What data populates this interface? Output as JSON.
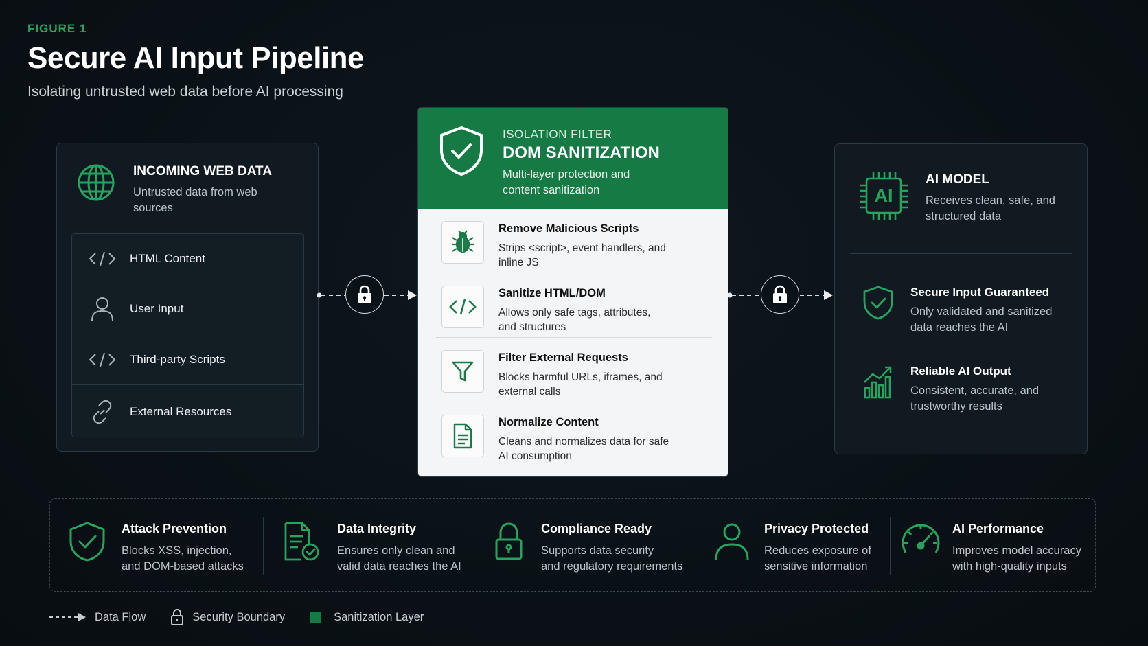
{
  "header": {
    "figure_label": "FIGURE 1",
    "title": "Secure AI Input Pipeline",
    "subtitle": "Isolating untrusted web data before AI processing"
  },
  "colors": {
    "accent": "#167a45",
    "accent_light": "#2fa866",
    "background": "#0a1116",
    "panel": "#111a21"
  },
  "incoming": {
    "icon": "globe-icon",
    "title": "INCOMING WEB DATA",
    "description": "Untrusted data from web sources",
    "items": [
      {
        "icon": "code-icon",
        "label": "HTML Content"
      },
      {
        "icon": "user-icon",
        "label": "User Input"
      },
      {
        "icon": "code-icon",
        "label": "Third-party Scripts"
      },
      {
        "icon": "link-icon",
        "label": "External Resources"
      }
    ]
  },
  "filter": {
    "icon": "shield-check-icon",
    "kicker": "ISOLATION FILTER",
    "title": "DOM SANITIZATION",
    "description": "Multi-layer protection and content sanitization",
    "steps": [
      {
        "icon": "bug-icon",
        "title": "Remove Malicious Scripts",
        "description": "Strips <script>, event handlers, and inline JS"
      },
      {
        "icon": "code-icon",
        "title": "Sanitize HTML/DOM",
        "description": "Allows only safe tags, attributes, and structures"
      },
      {
        "icon": "funnel-icon",
        "title": "Filter External Requests",
        "description": "Blocks harmful URLs, iframes, and external calls"
      },
      {
        "icon": "document-icon",
        "title": "Normalize Content",
        "description": "Cleans and normalizes data for safe AI consumption"
      }
    ]
  },
  "ai_model": {
    "icon": "ai-chip-icon",
    "chip_label": "AI",
    "title": "AI MODEL",
    "description": "Receives clean, safe, and structured data",
    "items": [
      {
        "icon": "shield-check-icon",
        "title": "Secure Input Guaranteed",
        "description": "Only validated and sanitized data reaches the AI"
      },
      {
        "icon": "growth-chart-icon",
        "title": "Reliable AI Output",
        "description": "Consistent, accurate, and trustworthy results"
      }
    ]
  },
  "benefits": [
    {
      "icon": "shield-check-icon",
      "title": "Attack Prevention",
      "line1": "Blocks XSS, injection,",
      "line2": "and DOM-based attacks"
    },
    {
      "icon": "document-check-icon",
      "title": "Data Integrity",
      "line1": "Ensures only clean and",
      "line2": "valid data reaches the AI"
    },
    {
      "icon": "padlock-icon",
      "title": "Compliance Ready",
      "line1": "Supports data security",
      "line2": "and regulatory requirements"
    },
    {
      "icon": "user-icon",
      "title": "Privacy Protected",
      "line1": "Reduces exposure of",
      "line2": "sensitive information"
    },
    {
      "icon": "gauge-icon",
      "title": "AI Performance",
      "line1": "Improves model accuracy",
      "line2": "with high-quality inputs"
    }
  ],
  "legend": [
    {
      "icon": "dashed-arrow-icon",
      "label": "Data Flow"
    },
    {
      "icon": "padlock-icon",
      "label": "Security Boundary"
    },
    {
      "icon": "green-square-icon",
      "label": "Sanitization Layer"
    }
  ]
}
